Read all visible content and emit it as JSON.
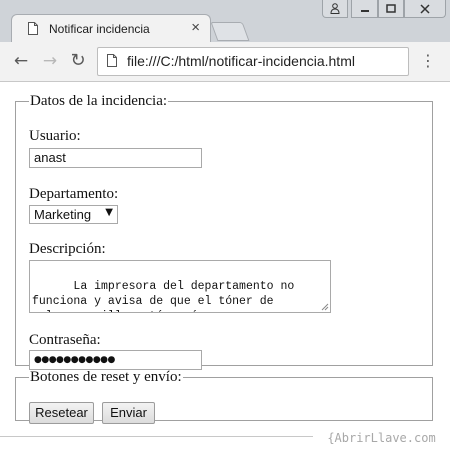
{
  "browser": {
    "tab_title": "Notificar incidencia",
    "tab_close": "×",
    "url": "file:///C:/html/notificar-incidencia.html",
    "window_buttons": {
      "user": "⍝",
      "minimize": "—",
      "maximize": "□",
      "close": "×"
    },
    "nav": {
      "back": "←",
      "forward": "→",
      "reload": "↻",
      "menu": "⋮"
    }
  },
  "form": {
    "incident_legend": "Datos de la incidencia:",
    "usuario_label": "Usuario:",
    "usuario_value": "anast",
    "departamento_label": "Departamento:",
    "departamento_value": "Marketing",
    "descripcion_label": "Descripción:",
    "descripcion_value": "La impresora del departamento no\nfunciona y avisa de que el tóner de\ncolor amarillo está vacío.",
    "contrasena_label": "Contraseña:",
    "contrasena_value": "●●●●●●●●●●●",
    "buttons_legend": "Botones de reset y envío:",
    "reset_label": "Resetear",
    "submit_label": "Enviar"
  },
  "watermark": "{AbrirLlave.com"
}
